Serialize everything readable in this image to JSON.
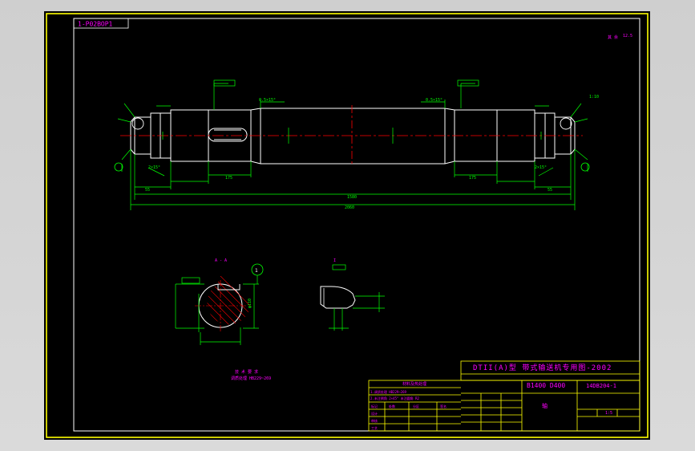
{
  "drawing": {
    "code_box": "1-P02BOP1",
    "corner_note": "其 余",
    "corner_roughness": "12.5",
    "section_label": "A - A",
    "detail_label": "I",
    "circle_label": "1"
  },
  "dimensions": {
    "overall_length": "2060",
    "middle_length": "1580",
    "hub_left": "175",
    "hub_right": "175",
    "end_left": "55",
    "end_right": "55",
    "section_dia": "φ110",
    "groove": "0.5×15°",
    "chamfer": "2×15°",
    "taper": "1:10"
  },
  "title_block": {
    "header": "DTII(A)型 带式输送机专用图-2002",
    "spec": "B1400 D400",
    "drawing_no": "14DB204-1",
    "part_name": "轴",
    "table_title": "材料及热处理",
    "scale": "1:5"
  },
  "colors": {
    "frame": "#ffff00",
    "outline": "#ffffff",
    "dimension": "#00ff00",
    "centerline": "#ff0000",
    "annotation": "#ff00ff",
    "hatch": "#ff0000",
    "leader": "#00ffff"
  }
}
